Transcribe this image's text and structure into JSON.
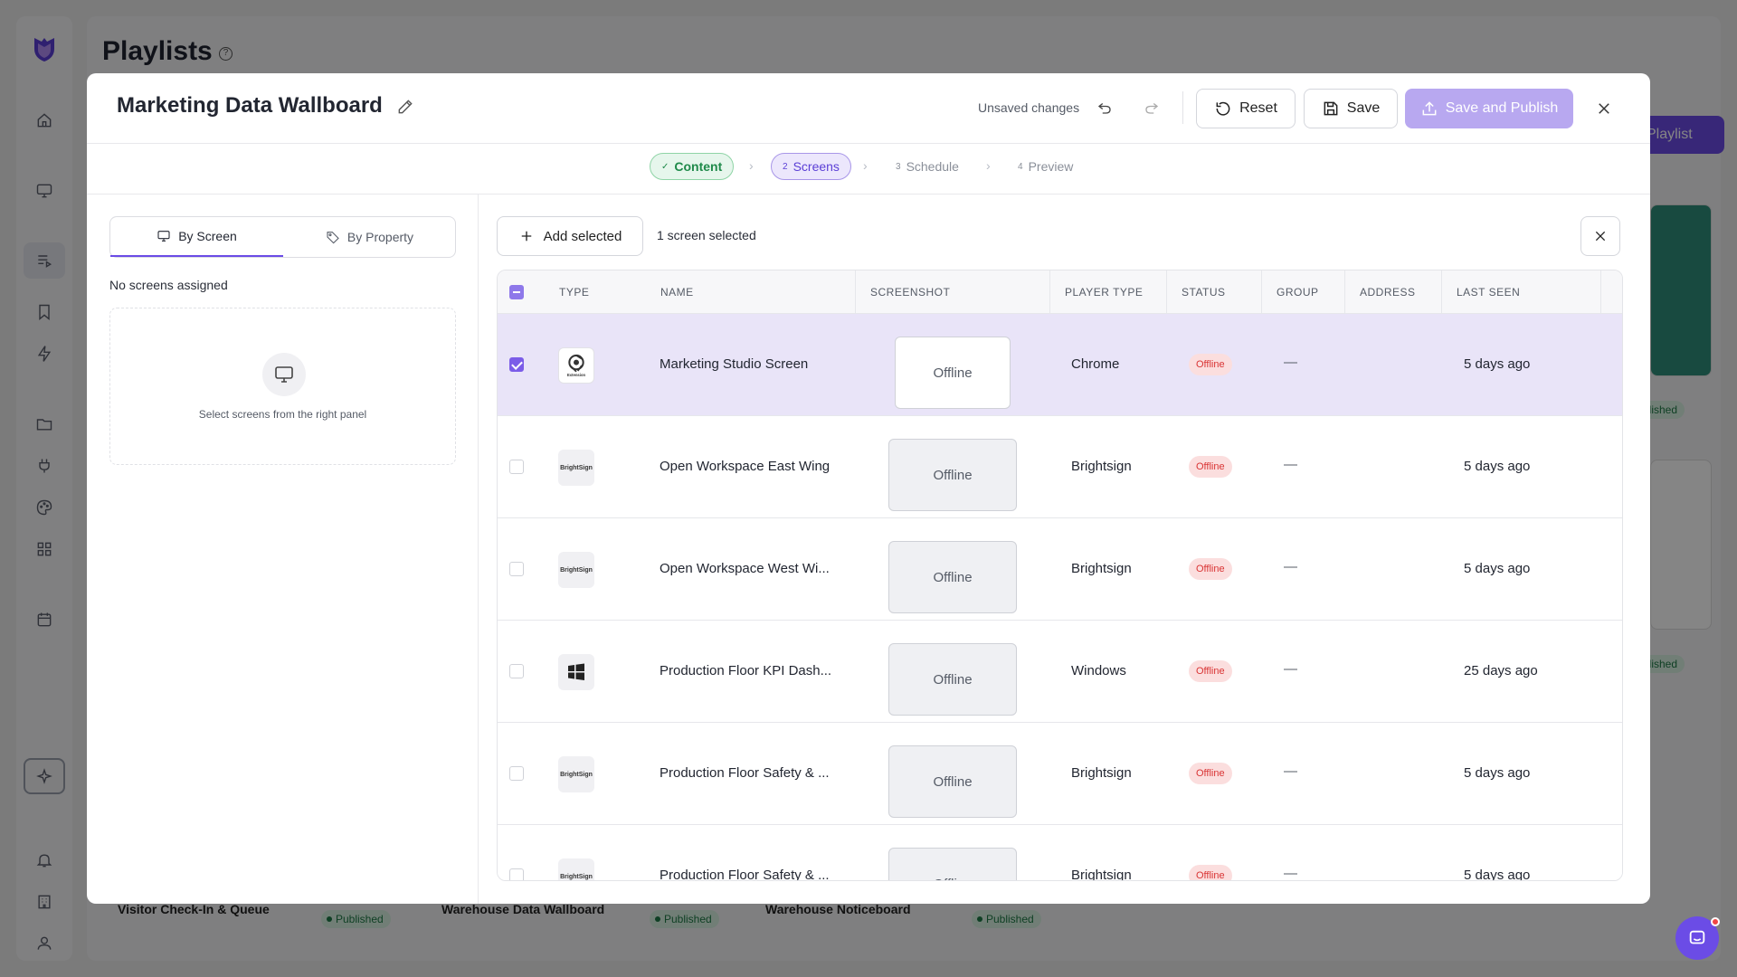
{
  "background": {
    "page_title": "Playlists",
    "help_icon": "question-circle-icon",
    "new_playlist_label": "Playlist",
    "published_label": "Published",
    "cards": [
      {
        "title": "Visitor Check-In & Queue",
        "status": "Published"
      },
      {
        "title": "Warehouse Data Wallboard",
        "status": "Published"
      },
      {
        "title": "Warehouse Noticeboard",
        "status": "Published"
      }
    ],
    "side_published": [
      "blished",
      "blished"
    ]
  },
  "sidebar": {
    "items": [
      "home-icon",
      "monitor-icon",
      "playlist-icon",
      "bookmark-icon",
      "lightning-icon",
      "folder-icon",
      "plug-icon",
      "palette-icon",
      "grid-icon",
      "calendar-icon",
      "sparkle-icon",
      "bell-icon",
      "building-icon",
      "user-icon"
    ]
  },
  "modal": {
    "title": "Marketing Data Wallboard",
    "unsaved_text": "Unsaved changes",
    "reset_label": "Reset",
    "save_label": "Save",
    "save_publish_label": "Save and Publish"
  },
  "stepper": {
    "steps": [
      {
        "num": "✓",
        "label": "Content",
        "state": "done"
      },
      {
        "num": "2",
        "label": "Screens",
        "state": "active"
      },
      {
        "num": "3",
        "label": "Schedule",
        "state": "pending"
      },
      {
        "num": "4",
        "label": "Preview",
        "state": "pending"
      }
    ]
  },
  "left_panel": {
    "tab_by_screen": "By Screen",
    "tab_by_property": "By Property",
    "no_screens": "No screens assigned",
    "empty_hint": "Select screens from the right panel"
  },
  "right_panel": {
    "add_selected_label": "Add selected",
    "selected_count": "1 screen selected",
    "columns": [
      "TYPE",
      "NAME",
      "SCREENSHOT",
      "PLAYER TYPE",
      "STATUS",
      "GROUP",
      "ADDRESS",
      "LAST SEEN"
    ],
    "rows": [
      {
        "type": "Chrome",
        "type_icon": "chrome-extension-icon",
        "name": "Marketing Studio Screen",
        "screenshot": "Offline",
        "player_type": "Chrome",
        "status": "Offline",
        "group": "—",
        "address": "",
        "last_seen": "5 days ago",
        "selected": true
      },
      {
        "type": "Brightsign",
        "type_icon": "brightsign-logo",
        "name": "Open Workspace East Wing",
        "screenshot": "Offline",
        "player_type": "Brightsign",
        "status": "Offline",
        "group": "—",
        "address": "",
        "last_seen": "5 days ago",
        "selected": false
      },
      {
        "type": "Brightsign",
        "type_icon": "brightsign-logo",
        "name": "Open Workspace West Wi...",
        "screenshot": "Offline",
        "player_type": "Brightsign",
        "status": "Offline",
        "group": "—",
        "address": "",
        "last_seen": "5 days ago",
        "selected": false
      },
      {
        "type": "Windows",
        "type_icon": "windows-icon",
        "name": "Production Floor KPI Dash...",
        "screenshot": "Offline",
        "player_type": "Windows",
        "status": "Offline",
        "group": "—",
        "address": "",
        "last_seen": "25 days ago",
        "selected": false
      },
      {
        "type": "Brightsign",
        "type_icon": "brightsign-logo",
        "name": "Production Floor Safety & ...",
        "screenshot": "Offline",
        "player_type": "Brightsign",
        "status": "Offline",
        "group": "—",
        "address": "",
        "last_seen": "5 days ago",
        "selected": false
      },
      {
        "type": "Brightsign",
        "type_icon": "brightsign-logo",
        "name": "Production Floor Safety & ...",
        "screenshot": "Offline",
        "player_type": "Brightsign",
        "status": "Offline",
        "group": "—",
        "address": "",
        "last_seen": "5 days ago",
        "selected": false
      }
    ],
    "brightsign_logo_text": "BrightSign",
    "chrome_logo_text": "Extension"
  },
  "colors": {
    "accent": "#6b4ce6",
    "selected_row": "#e9e4f8",
    "offline_chip_bg": "#fbdede",
    "offline_chip_text": "#d93434",
    "content_step": "#1f8a4a"
  }
}
